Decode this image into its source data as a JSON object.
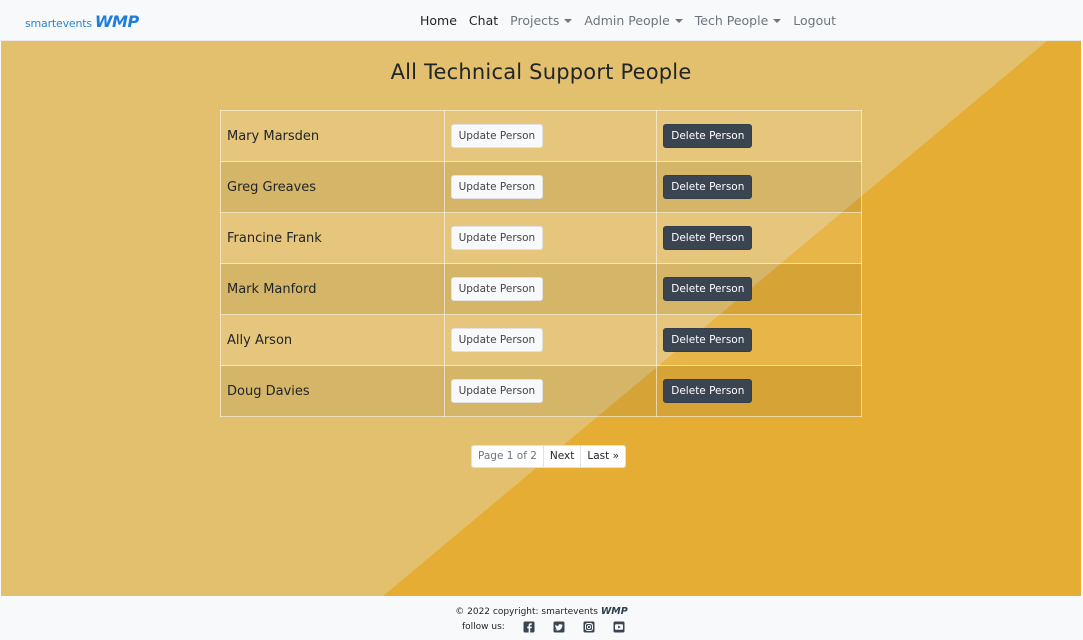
{
  "brand": {
    "small": "smartevents",
    "logo": "WMP"
  },
  "nav": {
    "home": "Home",
    "chat": "Chat",
    "projects": "Projects",
    "admin_people": "Admin People",
    "tech_people": "Tech People",
    "logout": "Logout"
  },
  "page": {
    "title": "All Technical Support People"
  },
  "people": [
    {
      "name": "Mary Marsden",
      "update": "Update Person",
      "delete": "Delete Person"
    },
    {
      "name": "Greg Greaves",
      "update": "Update Person",
      "delete": "Delete Person"
    },
    {
      "name": "Francine Frank",
      "update": "Update Person",
      "delete": "Delete Person"
    },
    {
      "name": "Mark Manford",
      "update": "Update Person",
      "delete": "Delete Person"
    },
    {
      "name": "Ally Arson",
      "update": "Update Person",
      "delete": "Delete Person"
    },
    {
      "name": "Doug Davies",
      "update": "Update Person",
      "delete": "Delete Person"
    }
  ],
  "pagination": {
    "current": "Page 1 of 2",
    "next": "Next",
    "last": "Last »"
  },
  "footer": {
    "copyright": "© 2022 copyright: smartevents",
    "copyright_logo": "WMP",
    "follow": "follow us:",
    "icons": [
      "facebook-icon",
      "twitter-icon",
      "instagram-icon",
      "youtube-icon"
    ]
  },
  "colors": {
    "main_bg": "#e3c06e",
    "diagonal": "#e5ad34",
    "delete_button": "#3b4451",
    "brand": "#1f7fd8"
  }
}
